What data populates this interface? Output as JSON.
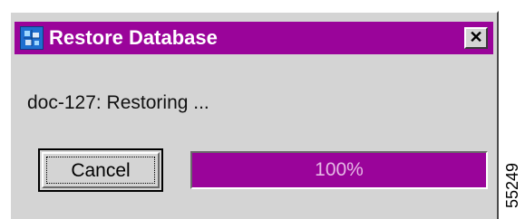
{
  "dialog": {
    "title": "Restore Database",
    "close_glyph": "✕",
    "message": "doc-127: Restoring ...",
    "cancel_label": "Cancel",
    "progress": {
      "value": 1.0,
      "label": "100%"
    }
  },
  "figure_id": "55249",
  "colors": {
    "title_bar": "#9a049a",
    "progress_fill": "#9a049a",
    "dialog_bg": "#d4d4d4"
  },
  "icons": {
    "app": "database-restore-icon",
    "close": "close-icon"
  }
}
